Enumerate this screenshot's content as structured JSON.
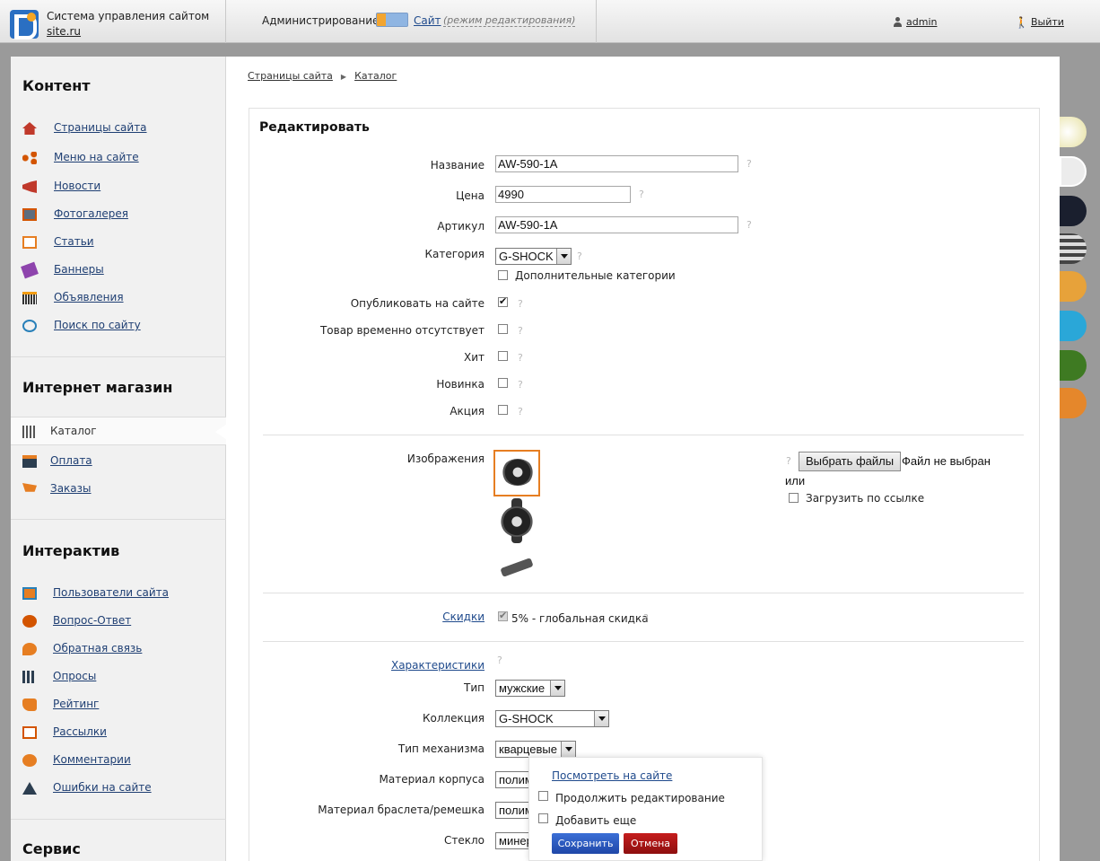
{
  "header": {
    "system_title": "Система управления сайтом",
    "site_name": "site.ru",
    "admin_label": "Администрирование",
    "site_label": "Сайт",
    "mode_note": "(режим редактирования)",
    "user": "admin",
    "logout": "Выйти"
  },
  "sidebar": {
    "content_title": "Контент",
    "content_items": [
      "Страницы сайта",
      "Меню на сайте",
      "Новости",
      "Фотогалерея",
      "Статьи",
      "Баннеры",
      "Объявления",
      "Поиск по сайту"
    ],
    "shop_title": "Интернет магазин",
    "shop_items": [
      "Каталог",
      "Оплата",
      "Заказы"
    ],
    "interactive_title": "Интерактив",
    "interactive_items": [
      "Пользователи сайта",
      "Вопрос-Ответ",
      "Обратная связь",
      "Опросы",
      "Рейтинг",
      "Рассылки",
      "Комментарии",
      "Ошибки на сайте"
    ],
    "service_title": "Сервис"
  },
  "breadcrumb": [
    "Страницы сайта",
    "Каталог"
  ],
  "form": {
    "title": "Редактировать",
    "name_label": "Название",
    "name_value": "AW-590-1A",
    "price_label": "Цена",
    "price_value": "4990",
    "article_label": "Артикул",
    "article_value": "AW-590-1A",
    "category_label": "Категория",
    "category_value": "G-SHOCK",
    "extra_categories": "Дополнительные категории",
    "publish_label": "Опубликовать на сайте",
    "absent_label": "Товар временно отсутствует",
    "hit_label": "Хит",
    "new_label": "Новинка",
    "sale_label": "Акция",
    "images_label": "Изображения",
    "choose_files": "Выбрать файлы",
    "no_file": "Файл не выбран",
    "or": "или",
    "upload_link": "Загрузить по ссылке",
    "discounts_label": "Скидки",
    "discount_value": "5% - глобальная скидка",
    "features_label": "Характеристики",
    "type_label": "Тип",
    "type_value": "мужские",
    "collection_label": "Коллекция",
    "collection_value": "G-SHOCK",
    "mechanism_label": "Тип механизма",
    "mechanism_value": "кварцевые",
    "case_label": "Материал корпуса",
    "case_value": "полим",
    "strap_label": "Материал браслета/ремешка",
    "strap_value": "полим",
    "glass_label": "Стекло",
    "glass_value": "минер",
    "help": "?"
  },
  "popup": {
    "view_on_site": "Посмотреть на сайте",
    "continue_edit": "Продолжить редактирование",
    "add_more": "Добавить еще",
    "save": "Сохранить",
    "cancel": "Отмена"
  },
  "colors": {
    "accent_orange": "#e67e22",
    "save_blue": "#1f47a8",
    "cancel_red": "#8d0f0f"
  }
}
